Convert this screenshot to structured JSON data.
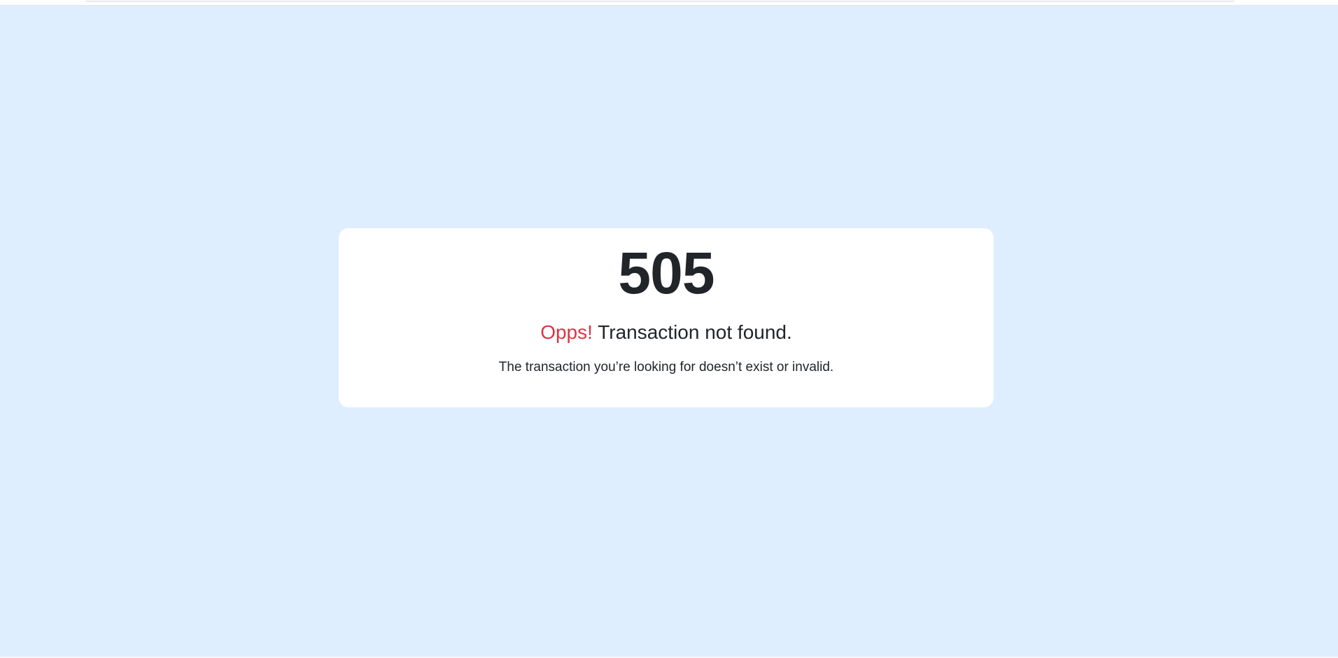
{
  "error": {
    "code": "505",
    "title_accent": "Opps!",
    "title_rest": "Transaction not found.",
    "message": "The transaction you’re looking for doesn’t exist or invalid."
  },
  "colors": {
    "background": "#deeefe",
    "card": "#ffffff",
    "text": "#212529",
    "accent": "#dc3545"
  }
}
